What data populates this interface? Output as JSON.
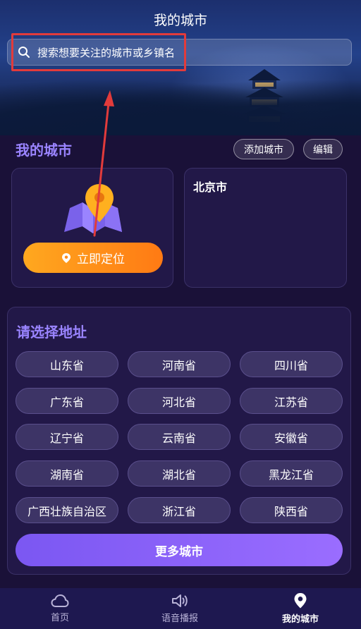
{
  "header": {
    "title": "我的城市"
  },
  "search": {
    "placeholder": "搜索想要关注的城市或乡镇名"
  },
  "my_city": {
    "title": "我的城市",
    "add_label": "添加城市",
    "edit_label": "编辑",
    "locate_label": "立即定位",
    "cities": [
      "北京市"
    ]
  },
  "select": {
    "title": "请选择地址",
    "provinces": [
      "山东省",
      "河南省",
      "四川省",
      "广东省",
      "河北省",
      "江苏省",
      "辽宁省",
      "云南省",
      "安徽省",
      "湖南省",
      "湖北省",
      "黑龙江省",
      "广西壮族自治区",
      "浙江省",
      "陕西省"
    ],
    "more_label": "更多城市"
  },
  "tabs": [
    {
      "label": "首页",
      "icon": "cloud-icon",
      "active": false
    },
    {
      "label": "语音播报",
      "icon": "speaker-icon",
      "active": false
    },
    {
      "label": "我的城市",
      "icon": "location-pin-icon",
      "active": true
    }
  ],
  "colors": {
    "accent_purple": "#9a84ff",
    "locate_orange": "#ff8a1a",
    "annotation_red": "#e23b3b"
  }
}
